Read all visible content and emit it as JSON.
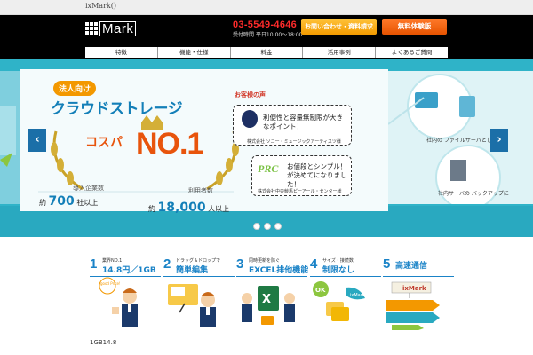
{
  "topbar": {
    "title": "ixMark()"
  },
  "header": {
    "logo_text": "Mark",
    "phone": "03-5549-4646",
    "hours": "受付時間 平日10:00～18:00",
    "contact_button": "お問い合わせ・資料請求",
    "trial_button": "無料体験版"
  },
  "nav": {
    "items": [
      "特徴",
      "機能・仕様",
      "料金",
      "活用事例",
      "よくあるご質問"
    ]
  },
  "hero": {
    "tag": "法人向け",
    "title": "クラウドストレージ",
    "kosupa": "コスパ",
    "no1": "NO.1",
    "stat1_label": "導入企業数",
    "stat1_prefix": "約",
    "stat1_value": "700",
    "stat1_suffix": "社以上",
    "stat2_label": "利用者数",
    "stat2_prefix": "約",
    "stat2_value": "18,000",
    "stat2_suffix": "人以上",
    "voice_head": "お客様の声",
    "voice1_text": "利便性と容量無制限が大きなポイント！",
    "voice1_company": "株式会社 ソニー・ミュージックアーティスツ様",
    "voice2_logo": "PRC",
    "voice2_text": "お値段とシンプル！が決めてになりました！",
    "voice2_company": "株式会社中央競馬ピーアール・センター様",
    "right_label1": "社内の ファイルサーバとして",
    "right_label2": "社内サーバの バックアップに",
    "prev_arrow": "‹",
    "next_arrow": "›"
  },
  "features": [
    {
      "num": "1",
      "small": "業界NO.1",
      "big": "14.8円／1GB"
    },
    {
      "num": "2",
      "small": "ドラッグ＆ドロップで",
      "big": "簡単編集"
    },
    {
      "num": "3",
      "small": "同時更新を防ぐ",
      "big": "EXCEL排他機能"
    },
    {
      "num": "4",
      "small": "サイズ・接続数",
      "big": "制限なし"
    },
    {
      "num": "5",
      "small": "",
      "big": "高速通信"
    }
  ],
  "illus": {
    "good_price": "good Price!",
    "ok": "OK",
    "ixmark_badge": "ixMark",
    "ixmark_board": "ixMark"
  },
  "footnote": "1GB14.8",
  "colors": {
    "accent_blue": "#1a83c7",
    "orange": "#f39800",
    "hero_teal": "#2fb3c8",
    "phone_red": "#ff2b2b"
  }
}
